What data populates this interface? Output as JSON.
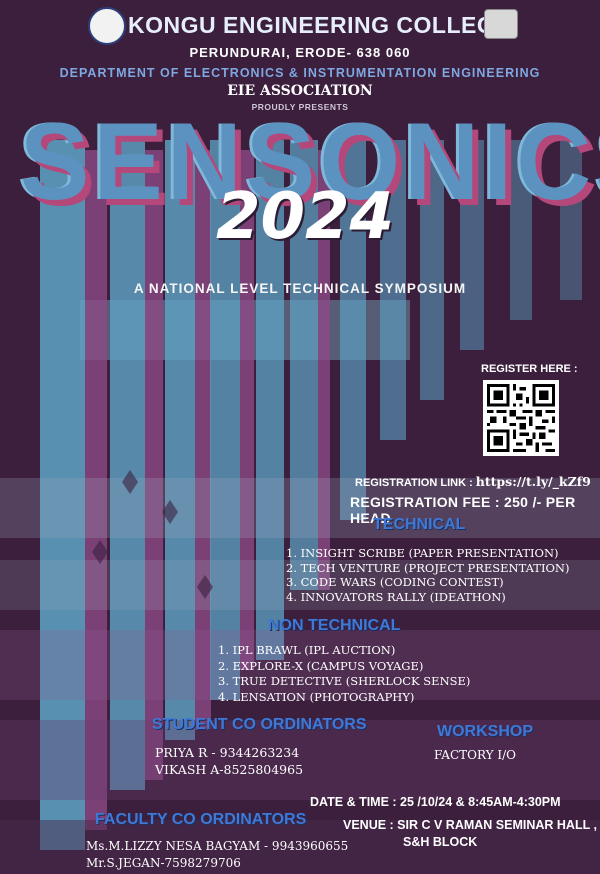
{
  "header": {
    "college": "KONGU ENGINEERING COLLEGE",
    "address": "PERUNDURAI, ERODE- 638 060",
    "department": "DEPARTMENT OF ELECTRONICS & INSTRUMENTATION ENGINEERING",
    "association": "EIE ASSOCIATION",
    "presents": "PROUDLY PRESENTS"
  },
  "event": {
    "name": "SENSONICS",
    "year": "2024",
    "tagline": "A NATIONAL LEVEL TECHNICAL SYMPOSIUM"
  },
  "registration": {
    "qr_label": "REGISTER HERE :",
    "link_label": "REGISTRATION LINK :",
    "link_url": "https://t.ly/_kZf9",
    "fee": "REGISTRATION FEE : 250 /- PER HEAD"
  },
  "technical": {
    "heading": "TECHNICAL",
    "items": [
      "1.  INSIGHT SCRIBE (PAPER PRESENTATION)",
      "2. TECH VENTURE (PROJECT PRESENTATION)",
      "3. CODE WARS (CODING CONTEST)",
      "4. INNOVATORS RALLY (IDEATHON)"
    ]
  },
  "non_technical": {
    "heading": "NON TECHNICAL",
    "items": [
      "1.  IPL BRAWL (IPL AUCTION)",
      "2.  EXPLORE-X (CAMPUS VOYAGE)",
      "3.  TRUE DETECTIVE (SHERLOCK SENSE)",
      "4.  LENSATION (PHOTOGRAPHY)"
    ]
  },
  "student_coordinators": {
    "heading": "STUDENT CO ORDINATORS",
    "items": [
      "PRIYA R - 9344263234",
      "VIKASH A-8525804965"
    ]
  },
  "workshop": {
    "heading": "WORKSHOP",
    "text": "FACTORY I/O"
  },
  "faculty_coordinators": {
    "heading": "FACULTY CO ORDINATORS",
    "items": [
      "Ms.M.LIZZY NESA BAGYAM - 9943960655",
      "Mr.S.JEGAN-7598279706"
    ]
  },
  "schedule": {
    "date": "DATE & TIME : 25 /10/24 & 8:45AM-4:30PM",
    "venue_line1": "VENUE : SIR C V RAMAN SEMINAR HALL ,",
    "venue_line2": "S&H BLOCK"
  },
  "colors": {
    "title_blue": "#5b92c0",
    "title_pink": "#b4487a",
    "heading_blue": "#3f78d6",
    "background": "#3a1c3a"
  }
}
